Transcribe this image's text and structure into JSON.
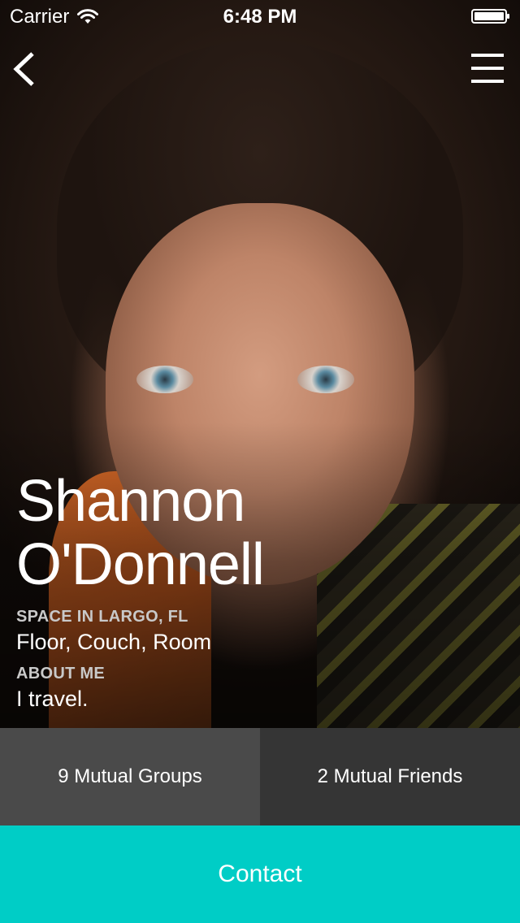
{
  "status_bar": {
    "carrier": "Carrier",
    "time": "6:48 PM"
  },
  "nav": {
    "back_icon": "chevron-left-icon",
    "menu_icon": "hamburger-menu-icon"
  },
  "profile": {
    "first_name": "Shannon",
    "last_name": "O'Donnell",
    "space_label": "SPACE IN LARGO, FL",
    "space_value": "Floor, Couch, Room",
    "about_label": "ABOUT ME",
    "about_value": "I travel."
  },
  "mutual": {
    "groups_label": "9 Mutual Groups",
    "friends_label": "2 Mutual Friends"
  },
  "contact": {
    "label": "Contact"
  },
  "colors": {
    "accent": "#00cdc6",
    "groups_bg": "#4a4a4a",
    "friends_bg": "#353535"
  }
}
